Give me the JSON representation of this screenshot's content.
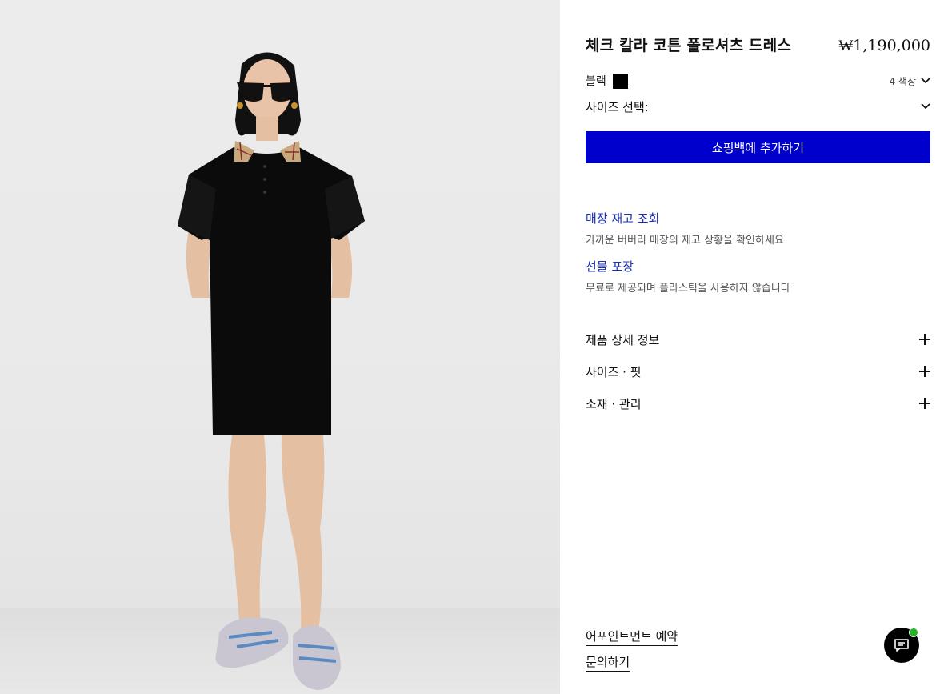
{
  "product": {
    "title": "체크 칼라 코튼 폴로셔츠 드레스",
    "price": "₩1,190,000",
    "image_alt": "product-model-photo"
  },
  "color": {
    "name": "블랙",
    "swatch_color": "#000000",
    "count_label": "4 색상"
  },
  "size": {
    "label": "사이즈 선택:"
  },
  "actions": {
    "add_to_bag": "쇼핑백에 추가하기",
    "accent_color": "#0000cc"
  },
  "services": [
    {
      "title": "매장 재고 조회",
      "subtitle": "가까운 버버리 매장의 재고 상황을 확인하세요"
    },
    {
      "title": "선물 포장",
      "subtitle": "무료로 제공되며 플라스틱을 사용하지 않습니다"
    }
  ],
  "accordions": [
    {
      "label": "제품 상세 정보"
    },
    {
      "label": "사이즈 · 핏"
    },
    {
      "label": "소재 · 관리"
    }
  ],
  "footer_links": {
    "appointment": "어포인트먼트 예약",
    "inquiry": "문의하기"
  },
  "chat": {
    "icon": "chat-icon",
    "status_color": "#22b822"
  }
}
